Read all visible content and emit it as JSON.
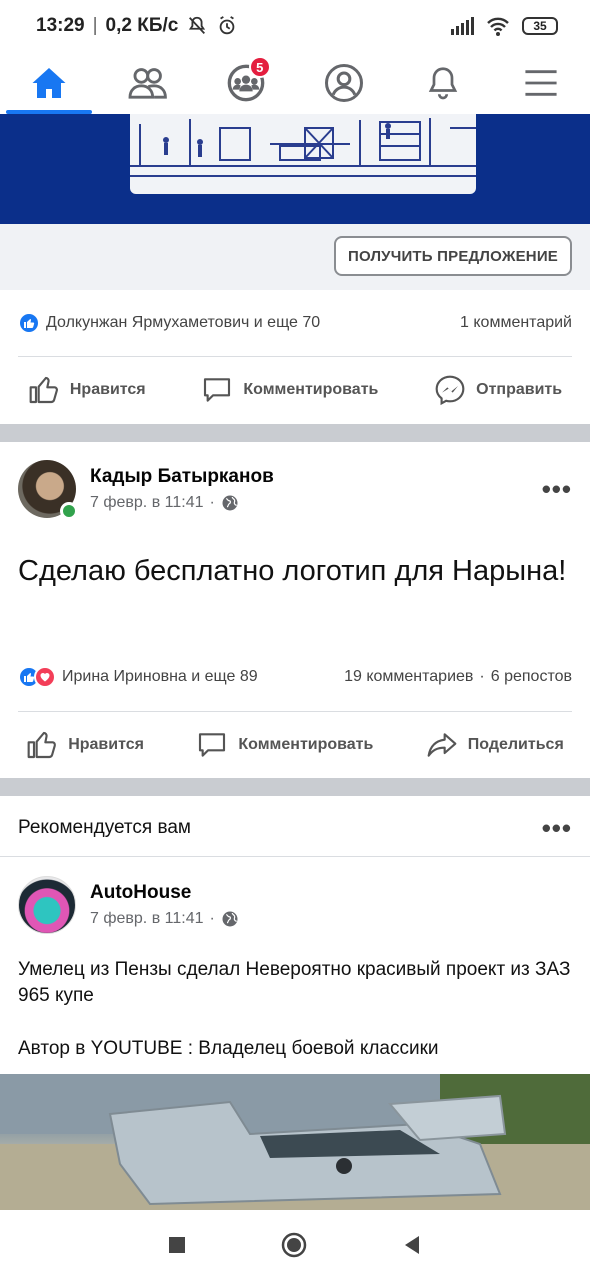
{
  "status_bar": {
    "time": "13:29",
    "speed": "0,2 КБ/с",
    "battery": "35"
  },
  "top_nav": {
    "groups_badge": "5"
  },
  "ad_post": {
    "cta_label": "ПОЛУЧИТЬ ПРЕДЛОЖЕНИЕ",
    "reactions_text": "Долкунжан Ярмухаметович и еще 70",
    "comments_text": "1 комментарий",
    "actions": {
      "like": "Нравится",
      "comment": "Комментировать",
      "send": "Отправить"
    }
  },
  "post1": {
    "author": "Кадыр Батырканов",
    "time": "7 февр. в 11:41",
    "text": "Сделаю бесплатно логотип для Нарына!",
    "reactions_text": "Ирина Ириновна и еще 89",
    "comments_text": "19 комментариев",
    "shares_text": "6 репостов",
    "actions": {
      "like": "Нравится",
      "comment": "Комментировать",
      "share": "Поделиться"
    }
  },
  "recommended": {
    "header": "Рекомендуется вам",
    "author": "AutoHouse",
    "time": "7 февр. в 11:41",
    "text_line1": "Умелец из Пензы сделал Невероятно красивый проект из ЗАЗ 965 купе",
    "text_line2": "Автор в YOUTUBE : Владелец боевой классики"
  },
  "colors": {
    "accent": "#1877f2",
    "badge": "#e41e3f",
    "online": "#31a24c",
    "banner": "#0b2f8a"
  }
}
